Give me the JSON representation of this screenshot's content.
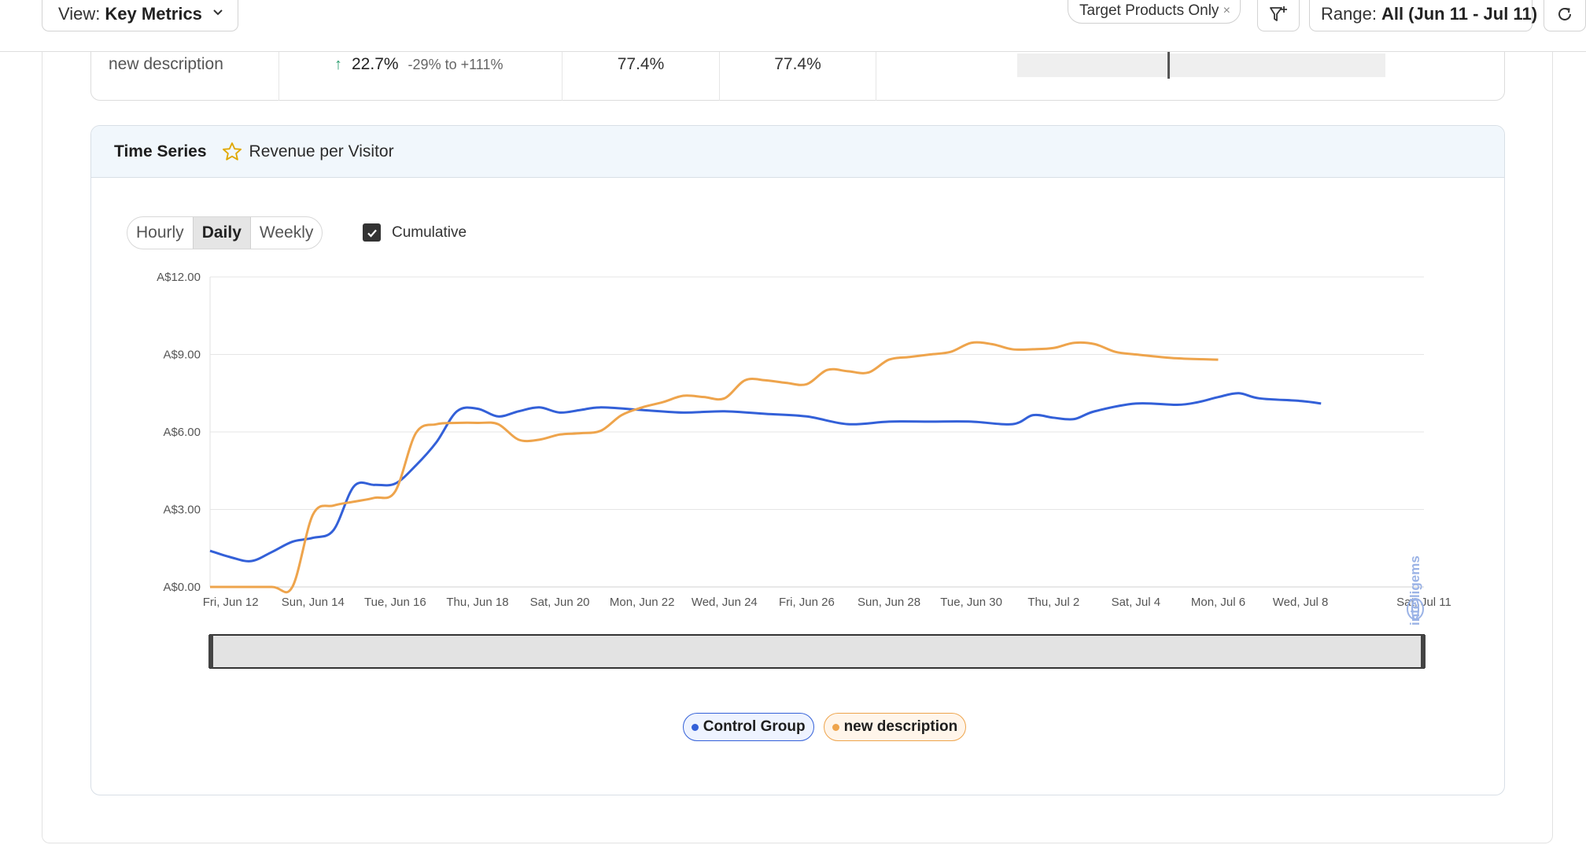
{
  "toolbar": {
    "view_label": "View:",
    "view_value": "Key Metrics",
    "chip_label": "Target Products Only",
    "chip_close": "×",
    "range_label": "Range:",
    "range_value": "All (Jun 11 - Jul 11)"
  },
  "table_row": {
    "name": "new description",
    "lift": "22.7%",
    "ci": "-29% to +111%",
    "prob1": "77.4%",
    "prob2": "77.4%"
  },
  "time_series": {
    "title": "Time Series",
    "metric": "Revenue per Visitor",
    "granularity": [
      "Hourly",
      "Daily",
      "Weekly"
    ],
    "granularity_selected": "Daily",
    "cumulative_label": "Cumulative",
    "cumulative_checked": true,
    "watermark": "intelligems"
  },
  "colors": {
    "control": "#3360d8",
    "variant": "#eea44c",
    "grid": "#e6e6e6",
    "header_bg": "#f1f7fc"
  },
  "chart_data": {
    "type": "line",
    "y_ticks": [
      "A$0.00",
      "A$3.00",
      "A$6.00",
      "A$9.00",
      "A$12.00"
    ],
    "ylim": [
      0,
      12
    ],
    "x_labels": [
      "Fri, Jun 12",
      "Sun, Jun 14",
      "Tue, Jun 16",
      "Thu, Jun 18",
      "Sat, Jun 20",
      "Mon, Jun 22",
      "Wed, Jun 24",
      "Fri, Jun 26",
      "Sun, Jun 28",
      "Tue, Jun 30",
      "Thu, Jul 2",
      "Sat, Jul 4",
      "Mon, Jul 6",
      "Wed, Jul 8",
      "Sat, Jul 11"
    ],
    "x_label_days": [
      1,
      3,
      5,
      7,
      9,
      11,
      13,
      15,
      17,
      19,
      21,
      23,
      25,
      27,
      30
    ],
    "xlim": [
      0.5,
      30
    ],
    "series": [
      {
        "name": "Control Group",
        "points": [
          [
            0.5,
            1.4
          ],
          [
            1,
            1.15
          ],
          [
            1.5,
            1.0
          ],
          [
            2,
            1.35
          ],
          [
            2.5,
            1.75
          ],
          [
            3,
            1.9
          ],
          [
            3.5,
            2.2
          ],
          [
            4,
            3.9
          ],
          [
            4.5,
            3.95
          ],
          [
            5,
            4.0
          ],
          [
            5.5,
            4.7
          ],
          [
            6,
            5.6
          ],
          [
            6.5,
            6.8
          ],
          [
            7,
            6.9
          ],
          [
            7.5,
            6.6
          ],
          [
            8,
            6.8
          ],
          [
            8.5,
            6.95
          ],
          [
            9,
            6.75
          ],
          [
            9.5,
            6.85
          ],
          [
            10,
            6.95
          ],
          [
            11,
            6.85
          ],
          [
            12,
            6.75
          ],
          [
            13,
            6.8
          ],
          [
            14,
            6.7
          ],
          [
            15,
            6.6
          ],
          [
            16,
            6.3
          ],
          [
            17,
            6.4
          ],
          [
            18,
            6.4
          ],
          [
            19,
            6.4
          ],
          [
            20,
            6.3
          ],
          [
            20.5,
            6.65
          ],
          [
            21,
            6.55
          ],
          [
            21.5,
            6.5
          ],
          [
            22,
            6.8
          ],
          [
            23,
            7.1
          ],
          [
            24,
            7.05
          ],
          [
            24.5,
            7.15
          ],
          [
            25,
            7.35
          ],
          [
            25.5,
            7.5
          ],
          [
            26,
            7.3
          ],
          [
            27,
            7.2
          ],
          [
            27.5,
            7.1
          ]
        ]
      },
      {
        "name": "new description",
        "points": [
          [
            0.5,
            0
          ],
          [
            1,
            0
          ],
          [
            2,
            0
          ],
          [
            2.5,
            0
          ],
          [
            3,
            2.8
          ],
          [
            3.5,
            3.15
          ],
          [
            4,
            3.3
          ],
          [
            4.5,
            3.45
          ],
          [
            5,
            3.7
          ],
          [
            5.5,
            5.95
          ],
          [
            6,
            6.3
          ],
          [
            6.5,
            6.35
          ],
          [
            7,
            6.35
          ],
          [
            7.5,
            6.3
          ],
          [
            8,
            5.7
          ],
          [
            8.5,
            5.7
          ],
          [
            9,
            5.9
          ],
          [
            9.5,
            5.95
          ],
          [
            10,
            6.05
          ],
          [
            10.5,
            6.65
          ],
          [
            11,
            6.95
          ],
          [
            11.5,
            7.15
          ],
          [
            12,
            7.4
          ],
          [
            12.5,
            7.35
          ],
          [
            13,
            7.3
          ],
          [
            13.5,
            8.0
          ],
          [
            14,
            8.0
          ],
          [
            14.5,
            7.9
          ],
          [
            15,
            7.85
          ],
          [
            15.5,
            8.4
          ],
          [
            16,
            8.35
          ],
          [
            16.5,
            8.3
          ],
          [
            17,
            8.8
          ],
          [
            17.5,
            8.9
          ],
          [
            18,
            9.0
          ],
          [
            18.5,
            9.1
          ],
          [
            19,
            9.45
          ],
          [
            19.5,
            9.4
          ],
          [
            20,
            9.2
          ],
          [
            20.5,
            9.2
          ],
          [
            21,
            9.25
          ],
          [
            21.5,
            9.45
          ],
          [
            22,
            9.4
          ],
          [
            22.5,
            9.1
          ],
          [
            23,
            9.0
          ],
          [
            24,
            8.85
          ],
          [
            25,
            8.8
          ]
        ]
      }
    ]
  }
}
